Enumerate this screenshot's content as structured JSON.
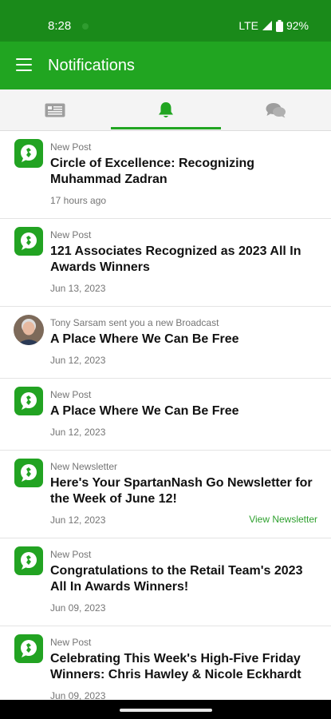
{
  "status_bar": {
    "time": "8:28",
    "network": "LTE",
    "battery": "92%"
  },
  "app_bar": {
    "title": "Notifications",
    "menu_icon": "hamburger-menu-icon"
  },
  "tabs": [
    {
      "icon": "newspaper-icon",
      "active": false
    },
    {
      "icon": "bell-icon",
      "active": true
    },
    {
      "icon": "chat-bubbles-icon",
      "active": false
    }
  ],
  "notifications": [
    {
      "type": "New Post",
      "title": "Circle of Excellence: Recognizing Muhammad Zadran",
      "date": "17 hours ago",
      "icon": "app-logo-icon"
    },
    {
      "type": "New Post",
      "title": "121 Associates Recognized as 2023 All In Awards Winners",
      "date": "Jun 13, 2023",
      "icon": "app-logo-icon"
    },
    {
      "type": "Tony Sarsam sent you a new Broadcast",
      "title": "A Place Where We Can Be Free",
      "date": "Jun 12, 2023",
      "icon": "avatar"
    },
    {
      "type": "New Post",
      "title": "A Place Where We Can Be Free",
      "date": "Jun 12, 2023",
      "icon": "app-logo-icon"
    },
    {
      "type": "New Newsletter",
      "title": "Here's Your SpartanNash Go Newsletter for the Week of June 12!",
      "date": "Jun 12, 2023",
      "action": "View Newsletter",
      "icon": "app-logo-icon"
    },
    {
      "type": "New Post",
      "title": "Congratulations to the Retail Team's 2023 All In Awards Winners!",
      "date": "Jun 09, 2023",
      "icon": "app-logo-icon"
    },
    {
      "type": "New Post",
      "title": "Celebrating This Week's High-Five Friday Winners: Chris Hawley & Nicole Eckhardt",
      "date": "Jun 09, 2023",
      "icon": "app-logo-icon"
    }
  ],
  "colors": {
    "status_bar": "#1a8a1a",
    "app_bar": "#21a521",
    "accent": "#21a521",
    "link": "#2ea02e"
  }
}
